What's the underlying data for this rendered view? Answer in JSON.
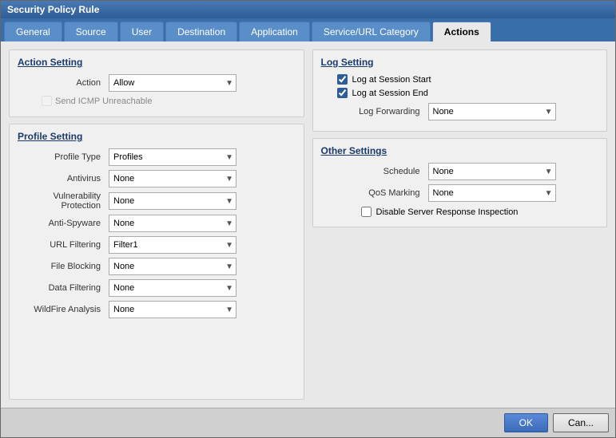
{
  "title": "Security Policy Rule",
  "tabs": [
    {
      "id": "general",
      "label": "General",
      "active": false
    },
    {
      "id": "source",
      "label": "Source",
      "active": false
    },
    {
      "id": "user",
      "label": "User",
      "active": false
    },
    {
      "id": "destination",
      "label": "Destination",
      "active": false
    },
    {
      "id": "application",
      "label": "Application",
      "active": false
    },
    {
      "id": "service-url",
      "label": "Service/URL Category",
      "active": false
    },
    {
      "id": "actions",
      "label": "Actions",
      "active": true
    }
  ],
  "action_setting": {
    "title": "Action Setting",
    "action_label": "Action",
    "action_value": "Allow",
    "send_icmp_label": "Send ICMP Unreachable"
  },
  "profile_setting": {
    "title": "Profile Setting",
    "profile_type_label": "Profile Type",
    "profile_type_value": "Profiles",
    "antivirus_label": "Antivirus",
    "antivirus_value": "None",
    "vuln_label": "Vulnerability Protection",
    "vuln_value": "None",
    "antispyware_label": "Anti-Spyware",
    "antispyware_value": "None",
    "url_label": "URL Filtering",
    "url_value": "Filter1",
    "file_label": "File Blocking",
    "file_value": "None",
    "data_label": "Data Filtering",
    "data_value": "None",
    "wildfire_label": "WildFire Analysis",
    "wildfire_value": "None"
  },
  "log_setting": {
    "title": "Log Setting",
    "log_session_start_label": "Log at Session Start",
    "log_session_start_checked": true,
    "log_session_end_label": "Log at Session End",
    "log_session_end_checked": true,
    "log_forwarding_label": "Log Forwarding",
    "log_forwarding_value": "None"
  },
  "other_settings": {
    "title": "Other Settings",
    "schedule_label": "Schedule",
    "schedule_value": "None",
    "qos_label": "QoS Marking",
    "qos_value": "None",
    "disable_server_label": "Disable Server Response Inspection"
  },
  "buttons": {
    "ok": "OK",
    "cancel": "Can..."
  }
}
